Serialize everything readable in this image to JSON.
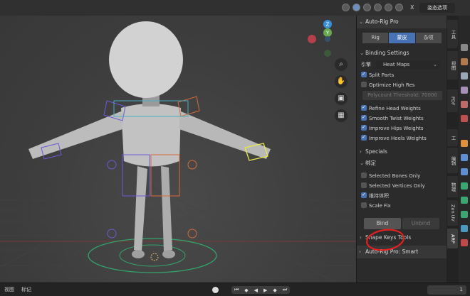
{
  "header": {
    "mode_label": "姿态选项",
    "close_label": "X"
  },
  "viewport": {
    "gizmo": {
      "z": "Z",
      "y": "Y"
    },
    "tools": [
      "zoom-icon",
      "hand-icon",
      "camera-icon",
      "grid-icon"
    ]
  },
  "panel": {
    "title": "Auto-Rig Pro",
    "tabs": [
      {
        "label": "Rig",
        "active": false
      },
      {
        "label": "蒙皮",
        "active": true
      },
      {
        "label": "杂项",
        "active": false
      }
    ],
    "binding_settings": "Binding Settings",
    "engine_label": "引擎",
    "engine_value": "Heat Maps",
    "split_parts": "Split Parts",
    "optimize_high_res": "Optimize High Res",
    "polycount_threshold": "Polycount Threshold: 70000",
    "refine_head_weights": "Refine Head Weights",
    "smooth_twist_weights": "Smooth Twist Weights",
    "improve_hips_weights": "Improve Hips Weights",
    "improve_heels_weights": "Improve Heels Weights",
    "specials": "Specials",
    "bind_section": "绑定",
    "selected_bones_only": "Selected Bones Only",
    "selected_vertices_only": "Selected Vertices Only",
    "preserve_volume": "维持体积",
    "scale_fix": "Scale Fix",
    "bind_button": "Bind",
    "unbind_button": "Unbind",
    "shape_keys_tools": "Shape Keys Tools",
    "smart_title": "Auto-Rig Pro: Smart"
  },
  "vertical_tabs": [
    "工具",
    "视图",
    "PDF",
    "工",
    "编辑",
    "物理",
    "Zen UV",
    "ARP"
  ],
  "bottom": {
    "view": "视图",
    "marker": "标记",
    "frame": "1"
  },
  "colors": {
    "accent": "#4772b3",
    "annotation_red": "#e02020"
  }
}
